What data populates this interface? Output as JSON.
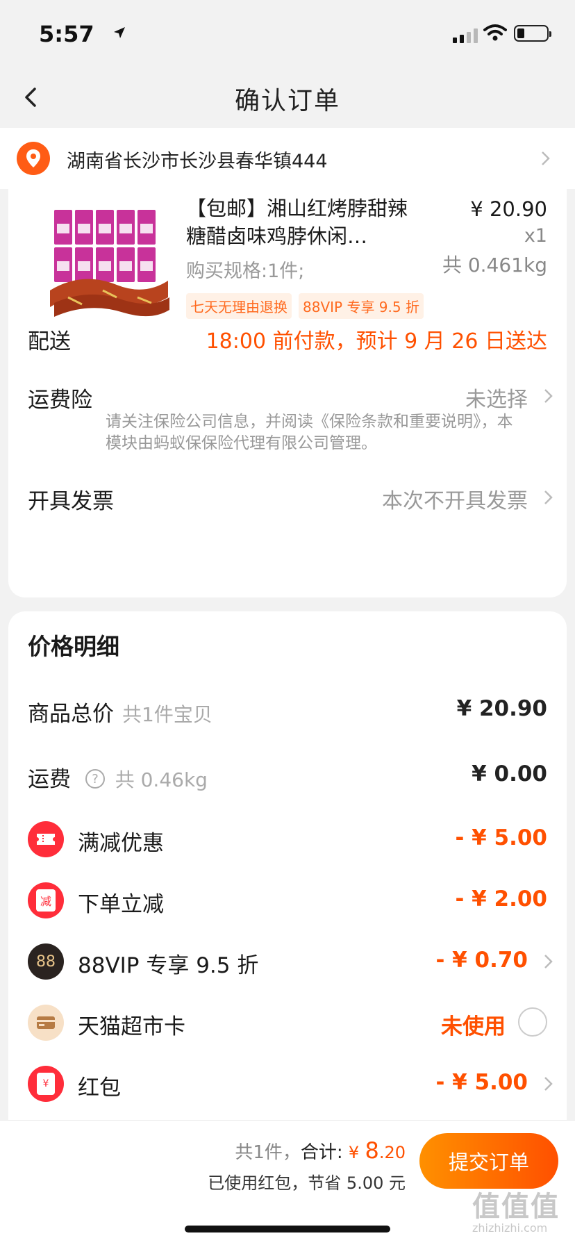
{
  "status_bar": {
    "time": "5:57"
  },
  "nav": {
    "title": "确认订单"
  },
  "address": {
    "text": "湖南省长沙市长沙县春华镇444"
  },
  "product": {
    "title": "【包邮】湘山红烤脖甜辣糖醋卤味鸡脖休闲…",
    "price": "¥ 20.90",
    "qty": "x1",
    "weight": "共 0.461kg",
    "spec": "购买规格:1件;",
    "tags": [
      "七天无理由退换",
      "88VIP 专享 9.5 折"
    ]
  },
  "delivery": {
    "label": "配送",
    "value": "18:00 前付款，预计 9 月 26 日送达"
  },
  "insurance": {
    "label": "运费险",
    "value": "未选择",
    "note": "请关注保险公司信息，并阅读《保险条款和重要说明》，本模块由蚂蚁保保险代理有限公司管理。"
  },
  "invoice": {
    "label": "开具发票",
    "value": "本次不开具发票"
  },
  "price_detail": {
    "title": "价格明细",
    "rows": [
      {
        "label": "商品总价",
        "sub": "共1件宝贝",
        "amount": "¥ 20.90"
      },
      {
        "label": "运费",
        "sub": "共 0.46kg",
        "amount": "¥ 0.00"
      }
    ],
    "discounts": [
      {
        "icon": "ticket-icon",
        "label": "满减优惠",
        "amount": "- ¥ 5.00"
      },
      {
        "icon": "discount-badge-icon",
        "label": "下单立减",
        "amount": "- ¥ 2.00",
        "icon_text": "减"
      },
      {
        "icon": "vip88-icon",
        "label": "88VIP 专享 9.5 折",
        "amount": "- ¥ 0.70",
        "icon_text": "88"
      },
      {
        "icon": "card-icon",
        "label": "天猫超市卡",
        "amount": "未使用"
      },
      {
        "icon": "red-envelope-icon",
        "label": "红包",
        "amount": "- ¥ 5.00",
        "icon_text": "¥"
      }
    ]
  },
  "footer": {
    "count": "共1件，",
    "total_label": "合计:",
    "currency": "¥",
    "total_main": "8",
    "total_cents": ".20",
    "saved": "已使用红包，节省 5.00 元",
    "submit": "提交订单"
  },
  "watermark": {
    "text": "值值值",
    "sub": "zhizhizhi.com"
  },
  "colors": {
    "accent": "#ff5000",
    "brand_gradient_start": "#ff9000"
  }
}
